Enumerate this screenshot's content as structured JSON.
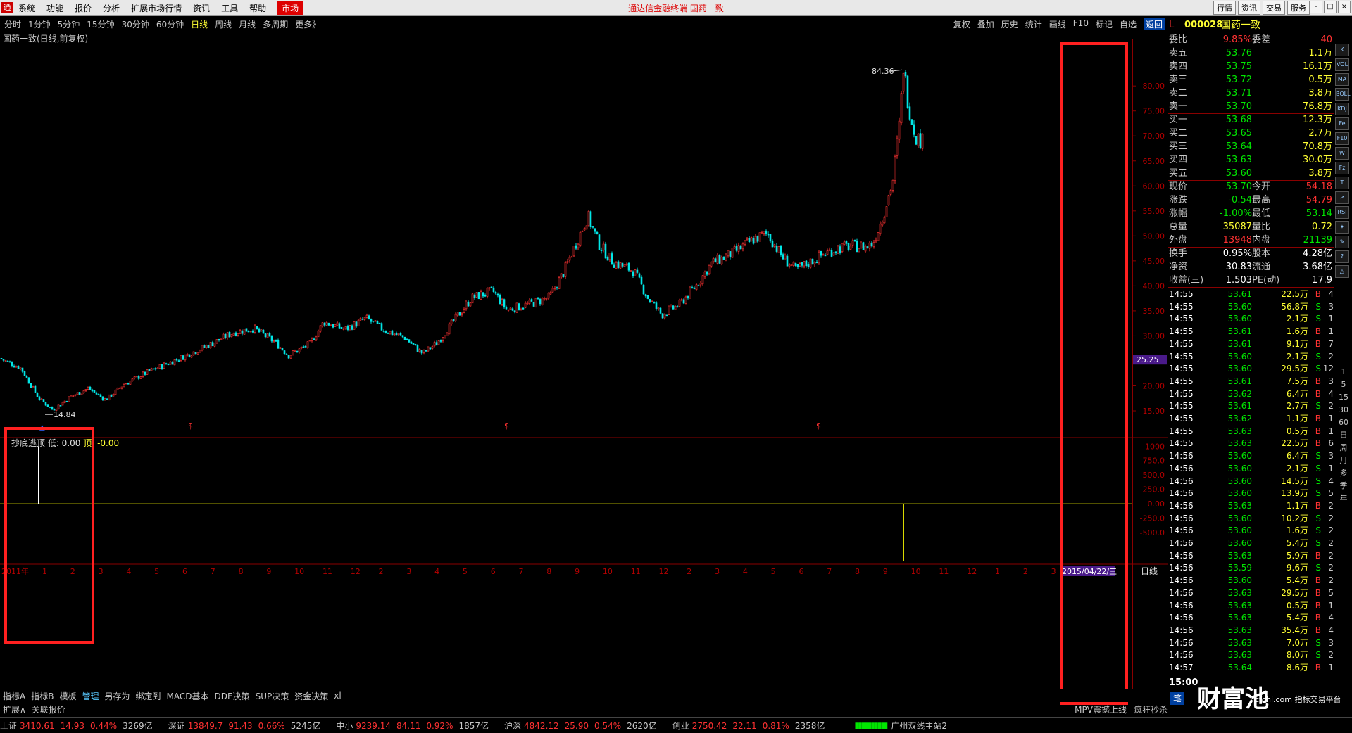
{
  "app": {
    "menu": [
      "系统",
      "功能",
      "报价",
      "分析",
      "扩展市场行情",
      "资讯",
      "工具",
      "帮助",
      "市场"
    ],
    "center_title": "通达信金融终端   国药一致",
    "right_buttons": [
      "行情",
      "资讯",
      "交易",
      "服务"
    ],
    "window_controls": [
      "-",
      "□",
      "×"
    ]
  },
  "toolbar": {
    "periods": [
      "分时",
      "1分钟",
      "5分钟",
      "15分钟",
      "30分钟",
      "60分钟",
      "日线",
      "周线",
      "月线",
      "多周期",
      "更多》"
    ],
    "active_period": "日线",
    "actions": [
      "复权",
      "叠加",
      "历史",
      "统计",
      "画线",
      "F10",
      "标记",
      "自选",
      "返回"
    ]
  },
  "stock_label": "国药一致(日线,前复权)",
  "chart_data": {
    "type": "candlestick",
    "title": "国药一致(日线,前复权)",
    "y_ticks": [
      15,
      20,
      25,
      30,
      35,
      40,
      45,
      50,
      55,
      60,
      65,
      70,
      75,
      80
    ],
    "y_tick_labels": [
      "15.00",
      "20.00",
      "25.00",
      "30.00",
      "35.00",
      "40.00",
      "45.00",
      "50.00",
      "55.00",
      "60.00",
      "65.00",
      "70.00",
      "75.00",
      "80.00"
    ],
    "ylim": [
      10.5,
      86.5
    ],
    "close_path_points": [
      [
        0,
        25.5
      ],
      [
        30,
        23.5
      ],
      [
        55,
        17.5
      ],
      [
        75,
        15.2
      ],
      [
        100,
        17.8
      ],
      [
        125,
        19.5
      ],
      [
        150,
        17.2
      ],
      [
        175,
        20.2
      ],
      [
        210,
        22.8
      ],
      [
        250,
        25.2
      ],
      [
        300,
        28.4
      ],
      [
        330,
        30.6
      ],
      [
        360,
        31.5
      ],
      [
        390,
        28.8
      ],
      [
        410,
        26.1
      ],
      [
        440,
        28.4
      ],
      [
        460,
        32.8
      ],
      [
        490,
        31.3
      ],
      [
        520,
        33.5
      ],
      [
        545,
        31.2
      ],
      [
        575,
        29.6
      ],
      [
        600,
        26.5
      ],
      [
        620,
        28.5
      ],
      [
        640,
        32.2
      ],
      [
        670,
        37.6
      ],
      [
        700,
        39.0
      ],
      [
        720,
        35.2
      ],
      [
        750,
        36.3
      ],
      [
        780,
        37.7
      ],
      [
        800,
        42.6
      ],
      [
        820,
        49.2
      ],
      [
        835,
        54.0
      ],
      [
        850,
        48.5
      ],
      [
        870,
        44.8
      ],
      [
        900,
        43.0
      ],
      [
        920,
        37.6
      ],
      [
        940,
        34.2
      ],
      [
        965,
        36.3
      ],
      [
        990,
        40.3
      ],
      [
        1010,
        44.5
      ],
      [
        1040,
        46.5
      ],
      [
        1070,
        49.3
      ],
      [
        1090,
        50.5
      ],
      [
        1110,
        46.0
      ],
      [
        1130,
        43.2
      ],
      [
        1150,
        44.7
      ],
      [
        1170,
        46.4
      ],
      [
        1190,
        47.6
      ],
      [
        1210,
        48.0
      ],
      [
        1230,
        47.8
      ],
      [
        1240,
        48.6
      ],
      [
        1255,
        54.5
      ],
      [
        1268,
        61.2
      ],
      [
        1278,
        73.2
      ],
      [
        1283,
        84.0
      ],
      [
        1290,
        76.5
      ],
      [
        1300,
        70.0
      ],
      [
        1310,
        68.8
      ]
    ],
    "high_marker": {
      "label": "84.36",
      "value": 84.36
    },
    "low_marker": {
      "label": "14.84",
      "value": 14.84
    },
    "current_price_tag": "25.25",
    "signal_marks": [
      "$",
      "$",
      "$"
    ],
    "indicator": {
      "name": "抄底逃顶",
      "low_label": "低: 0.00",
      "top_label": "顶: -0.00",
      "y_ticks": [
        1000,
        750,
        500,
        250,
        0,
        -250,
        -500,
        -750
      ],
      "y_tick_labels": [
        "1000",
        "750.0",
        "500.0",
        "250.0",
        "0.00",
        "-250.0",
        "-500.0",
        ""
      ],
      "ylim": [
        -1000,
        1150
      ],
      "spikes": [
        {
          "x": 55,
          "value": 990
        },
        {
          "x": 1283,
          "value": -990
        }
      ]
    },
    "x_axis": {
      "labels": [
        "2011年",
        "1",
        "2",
        "3",
        "4",
        "5",
        "6",
        "7",
        "8",
        "9",
        "10",
        "11",
        "12",
        "2",
        "3",
        "4",
        "5",
        "6",
        "7",
        "8",
        "9",
        "10",
        "11",
        "12",
        "2",
        "3",
        "4",
        "5",
        "6",
        "7",
        "8",
        "9",
        "10",
        "11",
        "12",
        "1",
        "2",
        "3",
        "4",
        "5"
      ],
      "cursor_date": "2015/04/22/三",
      "period_label": "日线"
    }
  },
  "panel": {
    "code": "000028",
    "name": "国药一致",
    "prefix": "L",
    "weibi_label": "委比",
    "weibi": "9.85%",
    "weicha_label": "委差",
    "weicha": "40",
    "sell": [
      {
        "label": "卖五",
        "price": "53.76",
        "vol": "1.1万"
      },
      {
        "label": "卖四",
        "price": "53.75",
        "vol": "16.1万"
      },
      {
        "label": "卖三",
        "price": "53.72",
        "vol": "0.5万"
      },
      {
        "label": "卖二",
        "price": "53.71",
        "vol": "3.8万"
      },
      {
        "label": "卖一",
        "price": "53.70",
        "vol": "76.8万"
      }
    ],
    "buy": [
      {
        "label": "买一",
        "price": "53.68",
        "vol": "12.3万"
      },
      {
        "label": "买二",
        "price": "53.65",
        "vol": "2.7万"
      },
      {
        "label": "买三",
        "price": "53.64",
        "vol": "70.8万"
      },
      {
        "label": "买四",
        "price": "53.63",
        "vol": "30.0万"
      },
      {
        "label": "买五",
        "price": "53.60",
        "vol": "3.8万"
      }
    ],
    "quotes": [
      {
        "l1": "现价",
        "v1": "53.70",
        "c1": "green",
        "l2": "今开",
        "v2": "54.18",
        "c2": "red"
      },
      {
        "l1": "涨跌",
        "v1": "-0.54",
        "c1": "green",
        "l2": "最高",
        "v2": "54.79",
        "c2": "red"
      },
      {
        "l1": "涨幅",
        "v1": "-1.00%",
        "c1": "green",
        "l2": "最低",
        "v2": "53.14",
        "c2": "green"
      },
      {
        "l1": "总量",
        "v1": "35087",
        "c1": "yellow",
        "l2": "量比",
        "v2": "0.72",
        "c2": "yellow"
      },
      {
        "l1": "外盘",
        "v1": "13948",
        "c1": "red",
        "l2": "内盘",
        "v2": "21139",
        "c2": "green"
      },
      {
        "l1": "换手",
        "v1": "0.95%",
        "c1": "white",
        "l2": "股本",
        "v2": "4.28亿",
        "c2": "white"
      },
      {
        "l1": "净资",
        "v1": "30.83",
        "c1": "white",
        "l2": "流通",
        "v2": "3.68亿",
        "c2": "white"
      },
      {
        "l1": "收益(三)",
        "v1": "1.503",
        "c1": "white",
        "l2": "PE(动)",
        "v2": "17.9",
        "c2": "white"
      }
    ],
    "ticks": [
      {
        "t": "14:55",
        "p": "53.61",
        "v": "22.5万",
        "bs": "B",
        "n": "4"
      },
      {
        "t": "14:55",
        "p": "53.60",
        "v": "56.8万",
        "bs": "S",
        "n": "3"
      },
      {
        "t": "14:55",
        "p": "53.60",
        "v": "2.1万",
        "bs": "S",
        "n": "1"
      },
      {
        "t": "14:55",
        "p": "53.61",
        "v": "1.6万",
        "bs": "B",
        "n": "1"
      },
      {
        "t": "14:55",
        "p": "53.61",
        "v": "9.1万",
        "bs": "B",
        "n": "7"
      },
      {
        "t": "14:55",
        "p": "53.60",
        "v": "2.1万",
        "bs": "S",
        "n": "2"
      },
      {
        "t": "14:55",
        "p": "53.60",
        "v": "29.5万",
        "bs": "S",
        "n": "12"
      },
      {
        "t": "14:55",
        "p": "53.61",
        "v": "7.5万",
        "bs": "B",
        "n": "3"
      },
      {
        "t": "14:55",
        "p": "53.62",
        "v": "6.4万",
        "bs": "B",
        "n": "4"
      },
      {
        "t": "14:55",
        "p": "53.61",
        "v": "2.7万",
        "bs": "S",
        "n": "2"
      },
      {
        "t": "14:55",
        "p": "53.62",
        "v": "1.1万",
        "bs": "B",
        "n": "1"
      },
      {
        "t": "14:55",
        "p": "53.63",
        "v": "0.5万",
        "bs": "B",
        "n": "1"
      },
      {
        "t": "14:55",
        "p": "53.63",
        "v": "22.5万",
        "bs": "B",
        "n": "6"
      },
      {
        "t": "14:56",
        "p": "53.60",
        "v": "6.4万",
        "bs": "S",
        "n": "3"
      },
      {
        "t": "14:56",
        "p": "53.60",
        "v": "2.1万",
        "bs": "S",
        "n": "1"
      },
      {
        "t": "14:56",
        "p": "53.60",
        "v": "14.5万",
        "bs": "S",
        "n": "4"
      },
      {
        "t": "14:56",
        "p": "53.60",
        "v": "13.9万",
        "bs": "S",
        "n": "5"
      },
      {
        "t": "14:56",
        "p": "53.63",
        "v": "1.1万",
        "bs": "B",
        "n": "2"
      },
      {
        "t": "14:56",
        "p": "53.60",
        "v": "10.2万",
        "bs": "S",
        "n": "2"
      },
      {
        "t": "14:56",
        "p": "53.60",
        "v": "1.6万",
        "bs": "S",
        "n": "2"
      },
      {
        "t": "14:56",
        "p": "53.60",
        "v": "5.4万",
        "bs": "S",
        "n": "2"
      },
      {
        "t": "14:56",
        "p": "53.63",
        "v": "5.9万",
        "bs": "B",
        "n": "2"
      },
      {
        "t": "14:56",
        "p": "53.59",
        "v": "9.6万",
        "bs": "S",
        "n": "2"
      },
      {
        "t": "14:56",
        "p": "53.60",
        "v": "5.4万",
        "bs": "B",
        "n": "2"
      },
      {
        "t": "14:56",
        "p": "53.63",
        "v": "29.5万",
        "bs": "B",
        "n": "5"
      },
      {
        "t": "14:56",
        "p": "53.63",
        "v": "0.5万",
        "bs": "B",
        "n": "1"
      },
      {
        "t": "14:56",
        "p": "53.63",
        "v": "5.4万",
        "bs": "B",
        "n": "4"
      },
      {
        "t": "14:56",
        "p": "53.63",
        "v": "35.4万",
        "bs": "B",
        "n": "4"
      },
      {
        "t": "14:56",
        "p": "53.63",
        "v": "7.0万",
        "bs": "S",
        "n": "3"
      },
      {
        "t": "14:56",
        "p": "53.63",
        "v": "8.0万",
        "bs": "S",
        "n": "2"
      },
      {
        "t": "14:57",
        "p": "53.64",
        "v": "8.6万",
        "bs": "B",
        "n": "1"
      }
    ],
    "last_time": "15:00",
    "bottom_tab": "笔",
    "side_icons": [
      "K",
      "VOL",
      "MA",
      "BOLL",
      "KDJ",
      "Fe",
      "F10",
      "W",
      "Fz",
      "T",
      "↗",
      "RSI",
      "✦",
      "✎",
      "?",
      "△"
    ],
    "side_timeframes": [
      "1",
      "5",
      "15",
      "30",
      "60",
      "日",
      "周",
      "月",
      "多",
      "季",
      "年"
    ]
  },
  "tabs_row1": [
    "指标A",
    "指标B",
    "模板",
    "管理",
    "另存为",
    "绑定到",
    "MACD基本",
    "DDE决策",
    "SUP决策",
    "资金决策",
    "xl"
  ],
  "tabs_row1_active": "管理",
  "tabs_row2": [
    "扩展∧",
    "关联报价"
  ],
  "tabs_row2_right": [
    "MPV震撼上线",
    "疯狂秒杀"
  ],
  "status": [
    {
      "name": "上证",
      "vals": [
        "3410.61",
        "14.93",
        "0.44%",
        "3269亿"
      ],
      "colors": [
        "red",
        "red",
        "red",
        "gray"
      ]
    },
    {
      "name": "深证",
      "vals": [
        "13849.7",
        "91.43",
        "0.66%",
        "5245亿"
      ],
      "colors": [
        "red",
        "red",
        "red",
        "gray"
      ]
    },
    {
      "name": "中小",
      "vals": [
        "9239.14",
        "84.11",
        "0.92%",
        "1857亿"
      ],
      "colors": [
        "red",
        "red",
        "red",
        "gray"
      ]
    },
    {
      "name": "沪深",
      "vals": [
        "4842.12",
        "25.90",
        "0.54%",
        "2620亿"
      ],
      "colors": [
        "red",
        "red",
        "red",
        "gray"
      ]
    },
    {
      "name": "创业",
      "vals": [
        "2750.42",
        "22.11",
        "0.81%",
        "2358亿"
      ],
      "colors": [
        "red",
        "red",
        "red",
        "gray"
      ]
    }
  ],
  "status_right": "广州双线主站2",
  "watermark": "财富池",
  "watermark_sub": "cfchi.com 指标交易平台",
  "colors": {
    "up": "#ff3232",
    "down": "#00e6e6",
    "grid": "#7a0000",
    "highlight": "#ff2020"
  }
}
